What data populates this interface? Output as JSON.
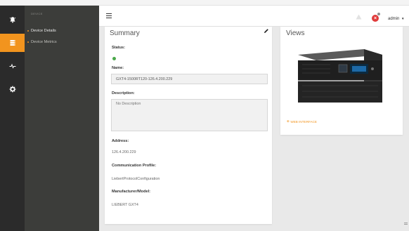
{
  "nav": {
    "section_label": "DEVICE",
    "items": [
      {
        "label": "Device Details"
      },
      {
        "label": "Device Metrics"
      }
    ]
  },
  "rail": {
    "items": [
      {
        "icon": "bell-icon",
        "active": false
      },
      {
        "icon": "server-icon",
        "active": true
      },
      {
        "icon": "pulse-icon",
        "active": false
      },
      {
        "icon": "gear-icon",
        "active": false
      }
    ]
  },
  "header": {
    "user": "admin",
    "alarm_badge": "0"
  },
  "summary": {
    "title": "Summary",
    "status_label": "Status:",
    "name_label": "Name:",
    "name_value": "GXT4-1500RT120-126.4.200.229",
    "description_label": "Description:",
    "description_placeholder": "No Description",
    "address_label": "Address:",
    "address_value": "126.4.200.229",
    "comm_profile_label": "Communication Profile:",
    "comm_profile_value": "LiebertProtocolConfiguration",
    "manufacturer_label": "Manufacturer/Model:",
    "manufacturer_value": "LIEBERT GXT4"
  },
  "views": {
    "title": "Views",
    "web_interface_label": "WEB INTERFACE"
  },
  "colors": {
    "accent": "#f2941e",
    "rail_bg": "#2b2b2b",
    "nav_bg": "#3c3d3a",
    "content_bg": "#e9e9e9",
    "alarm": "#e03b3b",
    "status_ok": "#4aa84a"
  }
}
